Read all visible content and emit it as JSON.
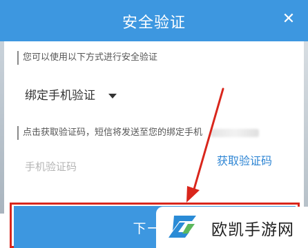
{
  "dialog": {
    "title": "安全验证",
    "close_icon": "close-icon",
    "notice": "您可以使用以下方式进行安全验证",
    "method": {
      "selected": "绑定手机验证"
    },
    "hint": "点击获取验证码，短信将发送至您的绑定手机",
    "code_field": {
      "placeholder": "手机验证码",
      "value": ""
    },
    "get_code_label": "获取验证码",
    "next_label": "下一步"
  },
  "colors": {
    "header": "#3d97e0",
    "link": "#2f86d4",
    "highlight": "#d9261c"
  },
  "watermark": {
    "text": "欧凯手游网"
  }
}
